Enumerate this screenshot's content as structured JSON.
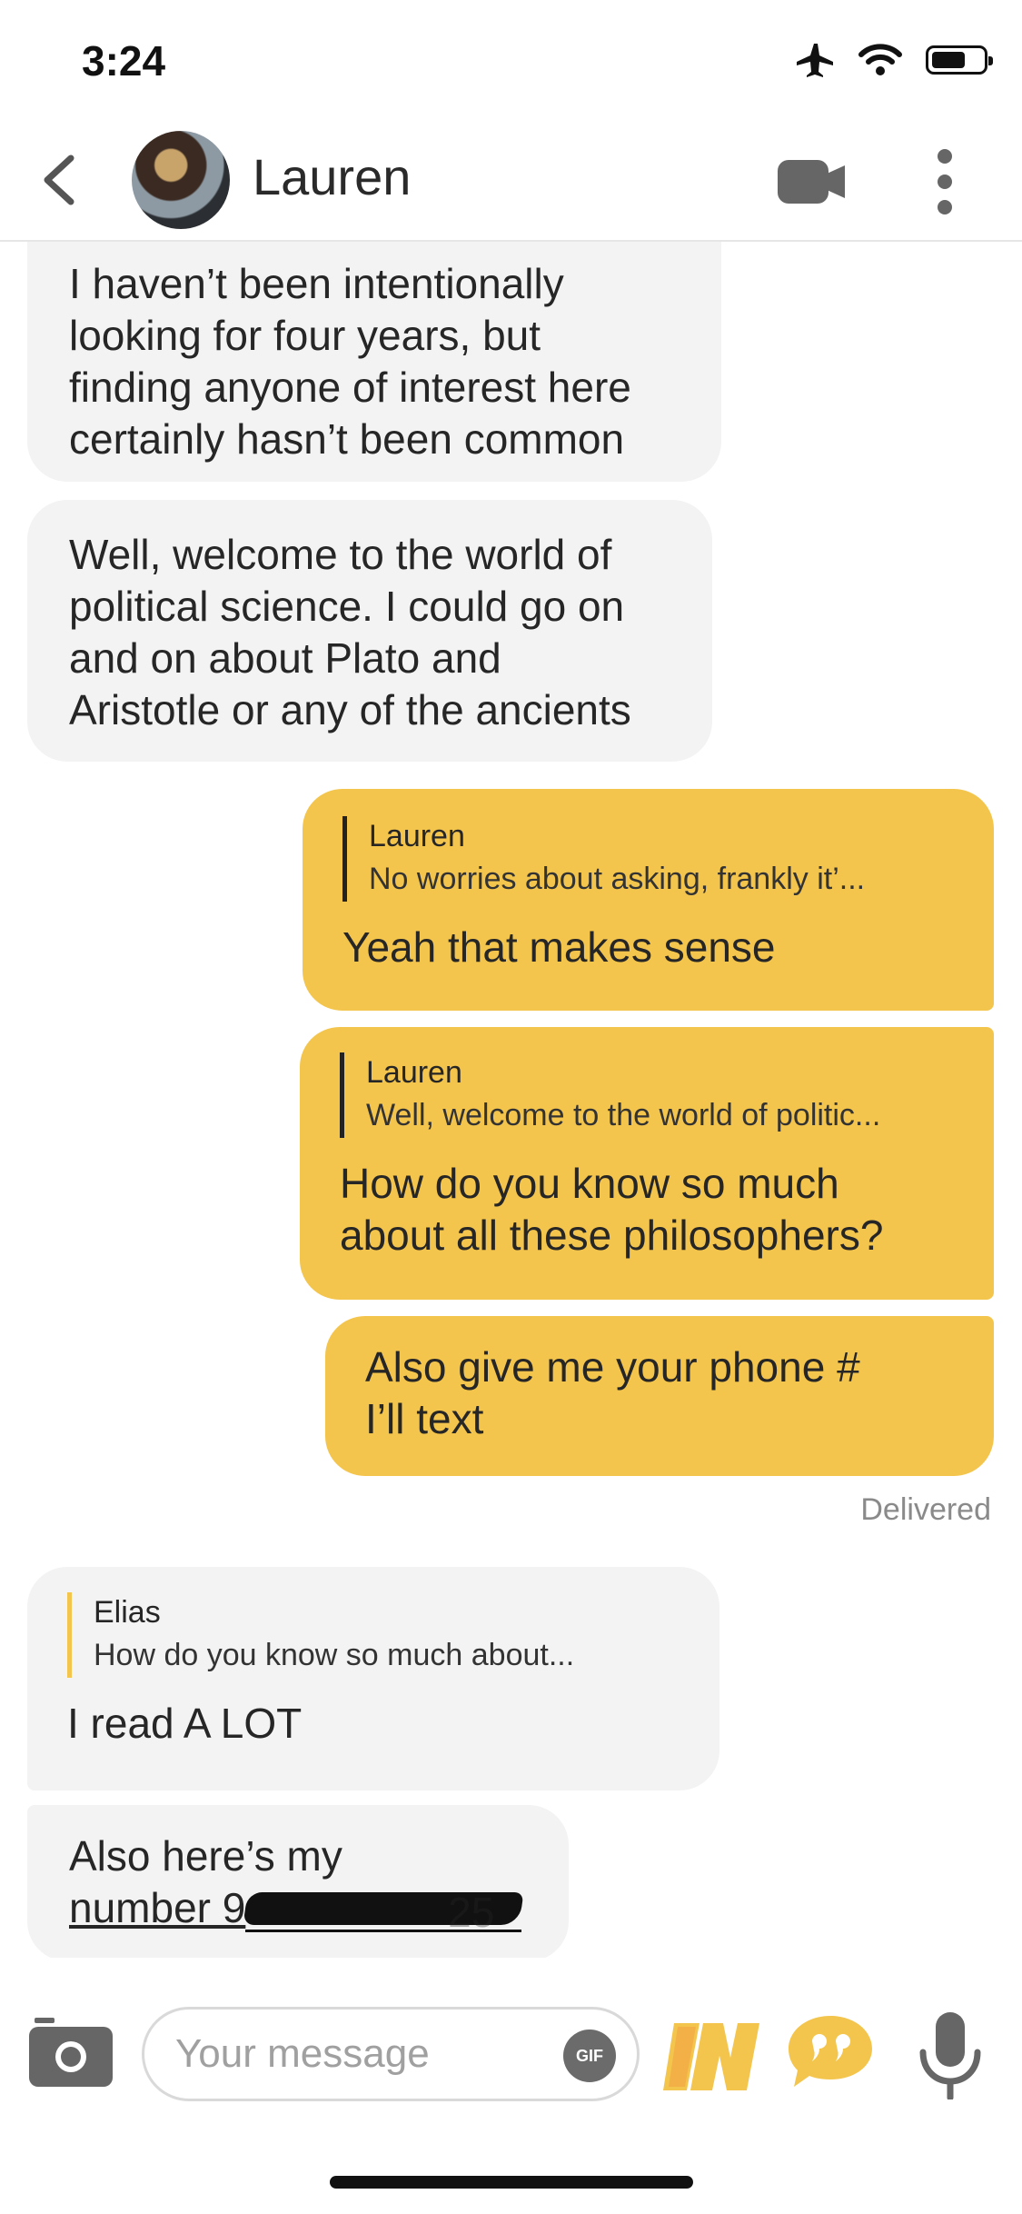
{
  "status_bar": {
    "time": "3:24"
  },
  "header": {
    "contact_name": "Lauren"
  },
  "messages": [
    {
      "direction": "in",
      "text": "I haven’t been intentionally\nlooking for four years, but\nfinding anyone of interest here\ncertainly hasn’t been common"
    },
    {
      "direction": "in",
      "text": "Well, welcome to the world of\npolitical science. I could go on\nand on about Plato and\nAristotle or any of the ancients"
    },
    {
      "direction": "out",
      "quote_name": "Lauren",
      "quote_text": "No worries about asking, frankly it’...",
      "text": "Yeah that makes sense"
    },
    {
      "direction": "out",
      "quote_name": "Lauren",
      "quote_text": "Well, welcome to the world of politic...",
      "text": "How do you know so much\nabout all these philosophers?"
    },
    {
      "direction": "out",
      "text": "Also give me your phone #\nI’ll text"
    },
    {
      "direction": "in",
      "quote_name": "Elias",
      "quote_text": "How do you know so much about...",
      "text": "I read A LOT"
    },
    {
      "direction": "in",
      "text_line1": "Also here’s my",
      "text_line2": "number 9",
      "redacted_tail": "25"
    }
  ],
  "delivered_label": "Delivered",
  "composer": {
    "placeholder": "Your message",
    "gif_label": "GIF"
  },
  "icons": [
    "back-icon",
    "video-call-icon",
    "more-icon",
    "camera-icon",
    "gif-icon",
    "in-icon",
    "quote-icon",
    "microphone-icon",
    "airplane-icon",
    "wifi-icon",
    "battery-icon"
  ],
  "colors": {
    "accent_yellow": "#f4c54c",
    "incoming_bubble": "#f3f3f3"
  },
  "battery_level_percent": 70
}
